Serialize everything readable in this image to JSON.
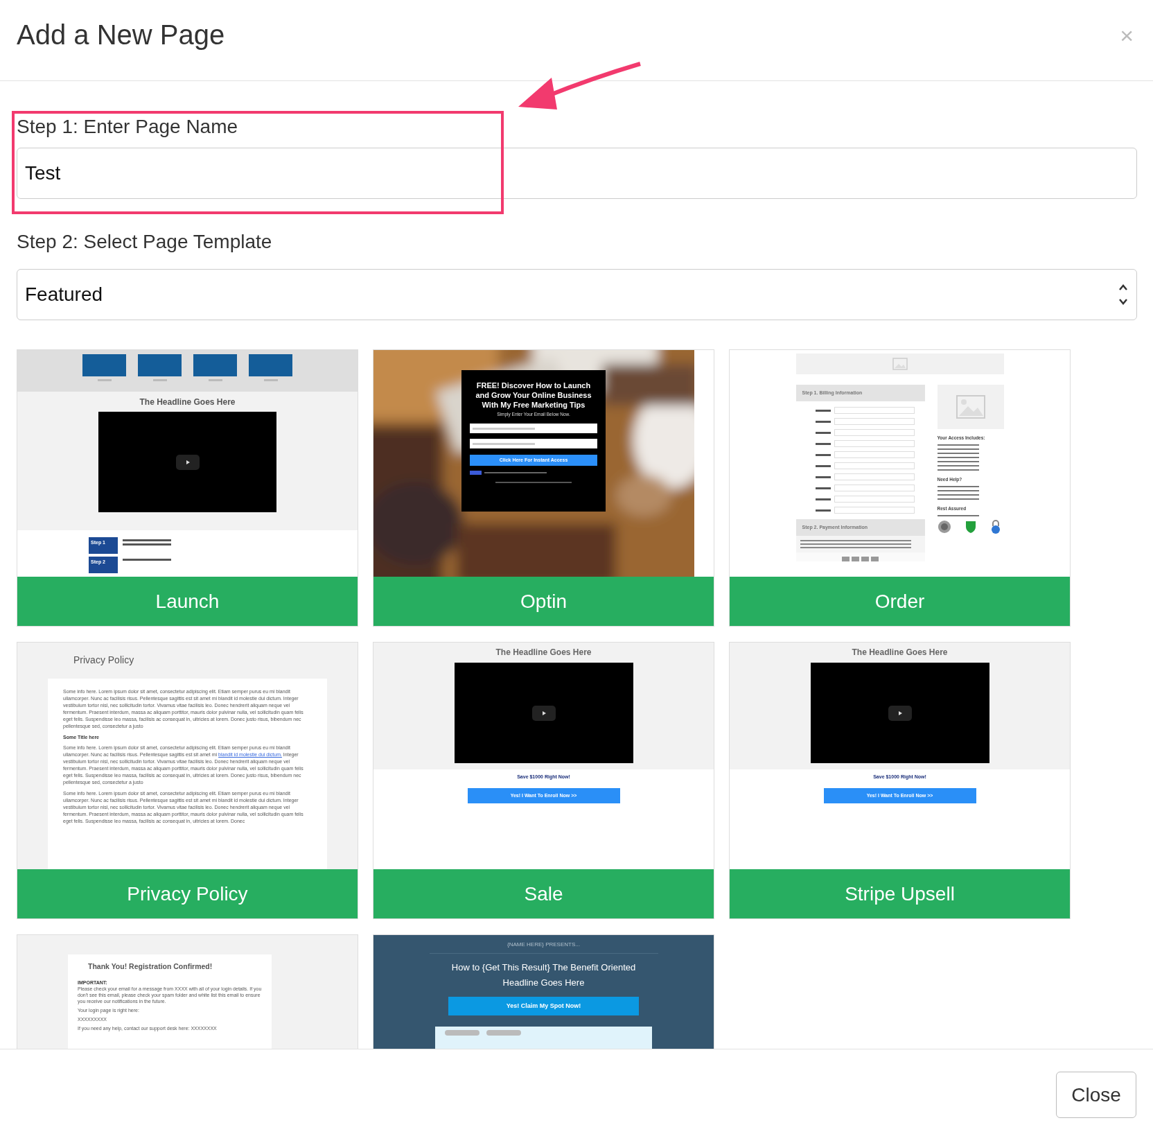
{
  "dialog": {
    "title": "Add a New Page",
    "close": "×"
  },
  "step1": {
    "label": "Step 1: Enter Page Name",
    "value": "Test"
  },
  "step2": {
    "label": "Step 2: Select Page Template",
    "value": "Featured"
  },
  "templates": [
    {
      "kind": "launch",
      "name": "Launch",
      "headline": "The Headline Goes Here",
      "steps": [
        "Step 1",
        "Step 2"
      ]
    },
    {
      "kind": "optin",
      "name": "Optin",
      "headline": "FREE! Discover How to Launch and Grow Your Online Business With My Free Marketing Tips",
      "subtitle": "Simply Enter Your Email Below Now.",
      "button": "Click Here For Instant Access"
    },
    {
      "kind": "order",
      "name": "Order",
      "sections": [
        "Step 1. Billing Information",
        "Step 2. Payment Information"
      ],
      "side_headings": [
        "Your Access Includes:",
        "Need Help?",
        "Rest Assured"
      ]
    },
    {
      "kind": "privacy",
      "name": "Privacy Policy",
      "title": "Privacy Policy",
      "paragraphs": [
        {
          "text": "Some info here. Lorem ipsum dolor sit amet, consectetur adipiscing elit. Etiam semper purus eu mi blandit ullamcorper. Nunc ac facilisis risus. Pellentesque sagittis est sit amet mi blandit id molestie dui dictum. Integer vestibulum tortor nisl, nec sollicitudin tortor. Vivamus vitae facilisis leo. Donec hendrerit aliquam neque vel fermentum. Praesent interdum, massa ac aliquam porttitor, mauris dolor pulvinar nulla, vel sollicitudin quam felis eget felis. Suspendisse leo massa, facilisis ac consequat in, ultricies at lorem. Donec justo risus, bibendum nec pellentesque sed, consectetur a justo"
        },
        {
          "kind": "heading",
          "text": "Some Title here"
        },
        {
          "text": "Some info here. Lorem ipsum dolor sit amet, consectetur adipiscing elit. Etiam semper purus eu mi blandit ullamcorper. Nunc ac facilisis risus. Pellentesque sagittis est sit amet mi",
          "link": "blandit id molestie dui dictum.",
          "after": "Integer vestibulum tortor nisl, nec sollicitudin tortor. Vivamus vitae facilisis leo. Donec hendrerit aliquam neque vel fermentum. Praesent interdum, massa ac aliquam porttitor, mauris dolor pulvinar nulla, vel sollicitudin quam felis eget felis. Suspendisse leo massa, facilisis ac consequat in, ultricies at lorem. Donec justo risus, bibendum nec pellentesque sed, consectetur a justo"
        },
        {
          "text": "Some info here. Lorem ipsum dolor sit amet, consectetur adipiscing elit. Etiam semper purus eu mi blandit ullamcorper. Nunc ac facilisis risus. Pellentesque sagittis est sit amet mi blandit id molestie dui dictum. Integer vestibulum tortor nisl, nec sollicitudin tortor. Vivamus vitae facilisis leo. Donec hendrerit aliquam neque vel fermentum. Praesent interdum, massa ac aliquam porttitor, mauris dolor pulvinar nulla, vel sollicitudin quam felis eget felis. Suspendisse leo massa, facilisis ac consequat in, ultricies at lorem. Donec"
        }
      ]
    },
    {
      "kind": "sale",
      "name": "Sale",
      "headline": "The Headline Goes Here",
      "offer": "Save $1000 Right Now!",
      "button": "Yes! I Want To Enroll Now >>"
    },
    {
      "kind": "sale",
      "name": "Stripe Upsell",
      "headline": "The Headline Goes Here",
      "offer": "Save $1000 Right Now!",
      "button": "Yes! I Want To Enroll Now >>"
    },
    {
      "kind": "thanks",
      "title": "Thank You! Registration Confirmed!",
      "lines": [
        {
          "kind": "heading",
          "text": "IMPORTANT:"
        },
        {
          "text": "Please check your email for a message from XXXX with all of your login details. If you don't see this email, please check your spam folder and white list this email to ensure you receive our notifications in the future."
        },
        {
          "text": "Your login page is right here:"
        },
        {
          "text": "XXXXXXXXX"
        },
        {
          "text": "If you need any help, contact our support desk here: XXXXXXXX"
        }
      ]
    },
    {
      "kind": "webinar",
      "kicker": "{NAME HERE} PRESENTS...",
      "headline": "How to {Get This Result} The Benefit Oriented Headline Goes Here",
      "button": "Yes! Claim My Spot Now!"
    }
  ],
  "footer": {
    "close_button": "Close"
  }
}
